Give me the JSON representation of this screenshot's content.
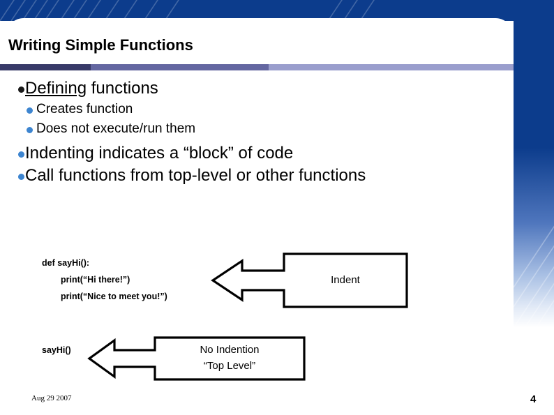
{
  "slide": {
    "title": "Writing Simple Functions",
    "accent_dark": "#383a68",
    "accent_mid": "#6467a1",
    "accent_light": "#9a9ecd",
    "background_blue": "#0c3c8c",
    "bullet_blue": "#3d85d0"
  },
  "bullets": [
    {
      "level": 1,
      "bullet_icon": "filled-circle-bullet-dark",
      "underlined_word": "Defining",
      "rest": " functions",
      "text": "Defining functions"
    },
    {
      "level": 2,
      "bullet_icon": "filled-circle-bullet-blue",
      "text": "Creates function"
    },
    {
      "level": 2,
      "bullet_icon": "filled-circle-bullet-blue",
      "text": "Does not execute/run them"
    },
    {
      "level": 1,
      "bullet_icon": "filled-circle-bullet-blue",
      "text": "Indenting indicates a “block” of code"
    },
    {
      "level": 1,
      "bullet_icon": "filled-circle-bullet-blue",
      "text": "Call functions from top-level or other functions"
    }
  ],
  "code_block": {
    "lines": [
      {
        "text": "def sayHi():",
        "indent": 0
      },
      {
        "text": "print(“Hi there!”)",
        "indent": 1
      },
      {
        "text": "print(“Nice to meet you!”)",
        "indent": 1
      }
    ],
    "call_expression": "sayHi()"
  },
  "callouts": [
    {
      "id": "indent",
      "label": "Indent",
      "shape": "left-arrow-callout"
    },
    {
      "id": "toplevel",
      "label": "No Indention\n“Top Level”",
      "shape": "left-arrow-callout"
    }
  ],
  "footer": {
    "date": "Aug 29 2007",
    "page_number": "4"
  }
}
